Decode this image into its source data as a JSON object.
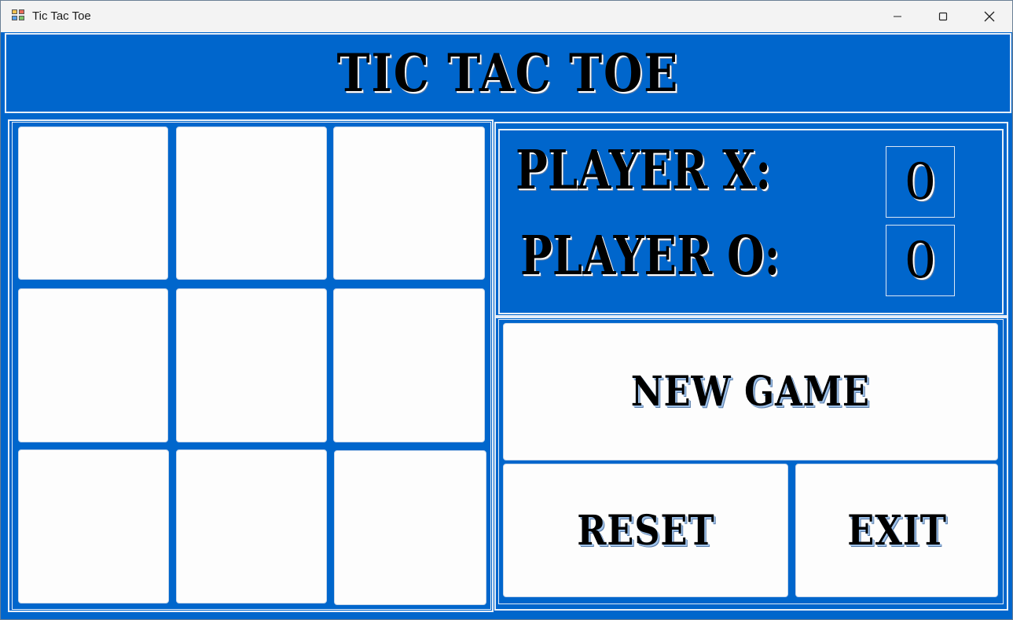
{
  "window": {
    "title": "Tic Tac Toe",
    "icon": "tic-tac-toe-app-icon"
  },
  "window_controls": {
    "minimize_icon": "minimize-icon",
    "maximize_icon": "maximize-icon",
    "close_icon": "close-icon"
  },
  "header": {
    "title": "TIC TAC TOE"
  },
  "board": {
    "cells": [
      "",
      "",
      "",
      "",
      "",
      "",
      "",
      "",
      ""
    ]
  },
  "scoreboard": {
    "player_x_label": "PLAYER X:",
    "player_x_score": "0",
    "player_o_label": "PLAYER O:",
    "player_o_score": "0"
  },
  "actions": {
    "new_game_label": "NEW GAME",
    "reset_label": "RESET",
    "exit_label": "EXIT"
  },
  "colors": {
    "background": "#0066cc",
    "cell": "#fdfdfd",
    "border": "#e6eef8"
  }
}
